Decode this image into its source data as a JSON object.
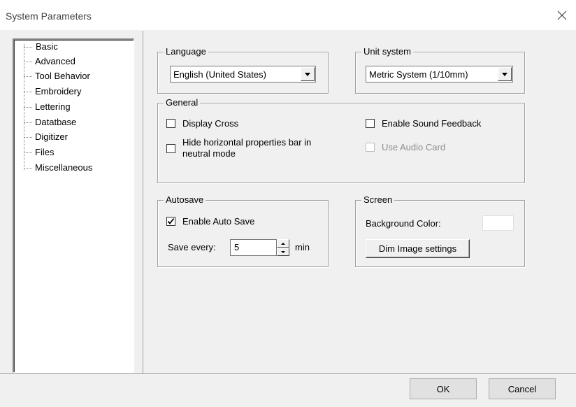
{
  "window": {
    "title": "System Parameters",
    "close_icon": "close-icon"
  },
  "tree": {
    "items": [
      {
        "label": "Basic",
        "selected": true
      },
      {
        "label": "Advanced",
        "selected": false
      },
      {
        "label": "Tool Behavior",
        "selected": false
      },
      {
        "label": "Embroidery",
        "selected": false
      },
      {
        "label": "Lettering",
        "selected": false
      },
      {
        "label": "Datatbase",
        "selected": false
      },
      {
        "label": "Digitizer",
        "selected": false
      },
      {
        "label": "Files",
        "selected": false
      },
      {
        "label": "Miscellaneous",
        "selected": false
      }
    ]
  },
  "language": {
    "group_title": "Language",
    "selected": "English (United States)"
  },
  "unit_system": {
    "group_title": "Unit system",
    "selected": "Metric System (1/10mm)"
  },
  "general": {
    "group_title": "General",
    "display_cross": {
      "label": "Display Cross",
      "checked": false
    },
    "hide_bar": {
      "label_line1": "Hide horizontal properties bar in",
      "label_line2": "neutral mode",
      "checked": false
    },
    "sound_feedback": {
      "label": "Enable Sound Feedback",
      "checked": false
    },
    "audio_card": {
      "label": "Use Audio Card",
      "checked": false,
      "disabled": true
    }
  },
  "autosave": {
    "group_title": "Autosave",
    "enable": {
      "label": "Enable Auto Save",
      "checked": true
    },
    "save_every_label": "Save every:",
    "save_every_value": "5",
    "unit": "min"
  },
  "screen": {
    "group_title": "Screen",
    "background_color_label": "Background Color:",
    "background_color": "#ffffff",
    "dim_button": "Dim Image settings"
  },
  "footer": {
    "ok": "OK",
    "cancel": "Cancel"
  }
}
